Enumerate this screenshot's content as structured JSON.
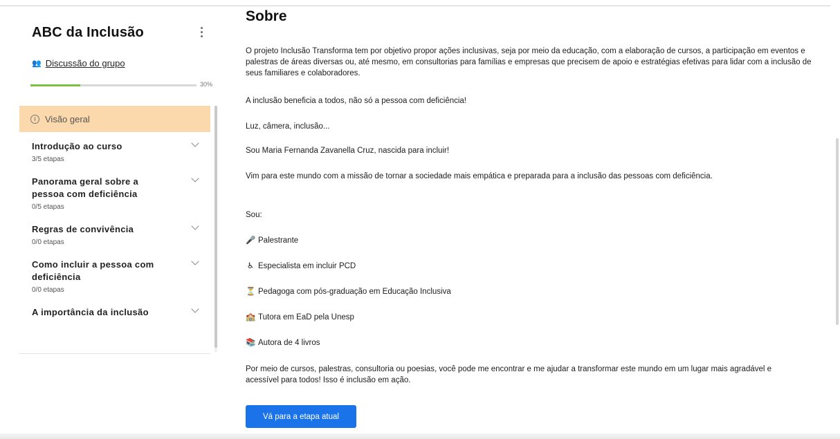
{
  "sidebar": {
    "course_title": "ABC da Inclusão",
    "group_link": "Discussão do grupo",
    "group_icon": "👥",
    "progress_label": "30%",
    "progress_value": 0.3,
    "progress_color": "#7cc144",
    "overview_label": "Visão geral",
    "overview_bg": "#fcd9ad",
    "modules": [
      {
        "title": "Introdução ao curso",
        "steps": "3/5 etapas"
      },
      {
        "title": "Panorama geral sobre a pessoa com deficiência",
        "steps": "0/5 etapas"
      },
      {
        "title": "Regras de convivência",
        "steps": "0/0 etapas"
      },
      {
        "title": "Como incluir a pessoa com deficiência",
        "steps": "0/0 etapas"
      },
      {
        "title": "A importância da inclusão",
        "steps": ""
      }
    ]
  },
  "main": {
    "heading": "Sobre",
    "paragraphs": [
      "O projeto Inclusão Transforma tem por objetivo propor ações inclusivas, seja por meio da educação, com a elaboração de cursos, a participação em eventos e palestras de áreas diversas ou, até mesmo, em consultorias para famílias e empresas que precisem de apoio e estratégias efetivas para lidar com a inclusão de seus familiares e colaboradores.",
      "A inclusão beneficia a todos, não só a pessoa com deficiência!",
      "Luz, câmera, inclusão...",
      "Sou Maria Fernanda Zavanella Cruz, nascida para incluir!",
      "Vim para este mundo com a missão de tornar a sociedade mais empática e preparada para a inclusão das pessoas com deficiência.",
      "Sou:"
    ],
    "roles": [
      {
        "icon": "🎤",
        "text": "Palestrante"
      },
      {
        "icon": "♿",
        "text": "Especialista em incluir PCD"
      },
      {
        "icon": "⏳",
        "text": "Pedagoga com pós-graduação em Educação Inclusiva"
      },
      {
        "icon": "🏫",
        "text": "Tutora em EaD pela Unesp"
      },
      {
        "icon": "📚",
        "text": "Autora de 4 livros"
      }
    ],
    "closing": "Por meio de cursos, palestras, consultoria ou poesias, você pode me encontrar e me ajudar a transformar este mundo em um lugar mais agradável e acessível para todos! Isso é inclusão em ação.",
    "button_label": "Vá para a etapa atual",
    "button_color": "#1a73e8"
  }
}
